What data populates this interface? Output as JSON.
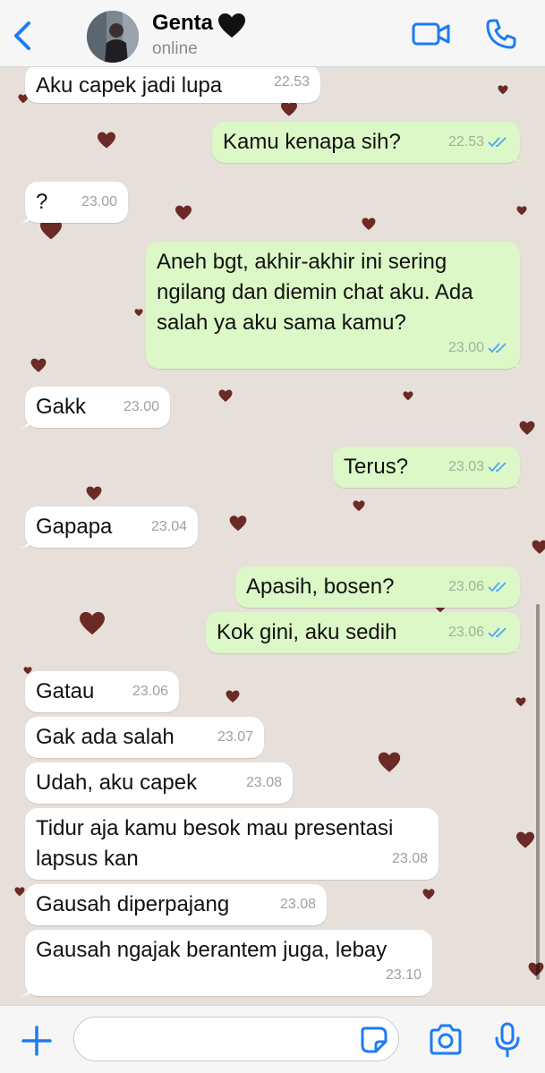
{
  "header": {
    "contact_name": "Genta",
    "name_emoji": "black-heart",
    "status": "online"
  },
  "colors": {
    "ios_blue": "#1c7cf3",
    "outgoing_bubble": "#dbf8c6",
    "incoming_bubble": "#ffffff",
    "wallpaper": "#e7dfd9",
    "wallpaper_heart": "#6b2a26",
    "read_ticks": "#4fa6f0"
  },
  "messages": [
    {
      "dir": "in",
      "text": "Aku capek jadi lupa",
      "time": "22.53"
    },
    {
      "dir": "out",
      "text": "Kamu kenapa sih?",
      "time": "22.53",
      "status": "read"
    },
    {
      "dir": "in",
      "text": "?",
      "time": "23.00"
    },
    {
      "dir": "out",
      "text": "Aneh bgt, akhir-akhir ini sering\nngilang dan diemin chat aku. Ada\nsalah ya aku sama kamu?",
      "time": "23.00",
      "status": "read"
    },
    {
      "dir": "in",
      "text": "Gakk",
      "time": "23.00"
    },
    {
      "dir": "out",
      "text": "Terus?",
      "time": "23.03",
      "status": "read"
    },
    {
      "dir": "in",
      "text": "Gapapa",
      "time": "23.04"
    },
    {
      "dir": "out",
      "text": "Apasih, bosen?",
      "time": "23.06",
      "status": "read"
    },
    {
      "dir": "out",
      "text": "Kok gini, aku sedih",
      "time": "23.06",
      "status": "read"
    },
    {
      "dir": "in",
      "text": "Gatau",
      "time": "23.06"
    },
    {
      "dir": "in",
      "text": "Gak ada salah",
      "time": "23.07"
    },
    {
      "dir": "in",
      "text": "Udah, aku capek",
      "time": "23.08"
    },
    {
      "dir": "in",
      "text": "Tidur aja kamu besok mau presentasi\nlapsus kan",
      "time": "23.08"
    },
    {
      "dir": "in",
      "text": "Gausah diperpajang",
      "time": "23.08"
    },
    {
      "dir": "in",
      "text": "Gausah ngajak berantem juga, lebay",
      "time": "23.10"
    }
  ],
  "composer": {
    "value": "",
    "placeholder": ""
  },
  "icons": {
    "back": "chevron-left-icon",
    "video": "video-call-icon",
    "call": "phone-icon",
    "plus": "plus-icon",
    "sticker": "sticker-icon",
    "camera": "camera-icon",
    "mic": "microphone-icon"
  }
}
